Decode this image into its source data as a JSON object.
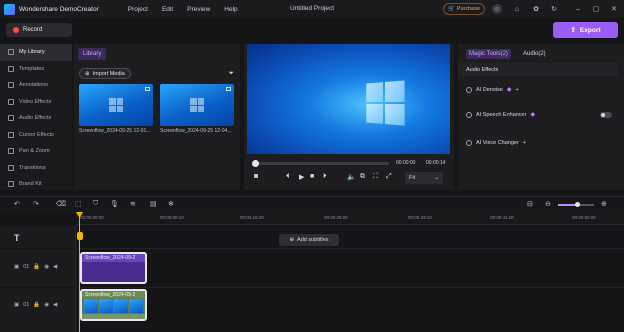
{
  "titlebar": {
    "app_name": "Wondershare DemoCreator",
    "menu": [
      "Project",
      "Edit",
      "Preview",
      "Help"
    ],
    "project_title": "Untitled Project",
    "purchase_label": "Purchase"
  },
  "record_label": "Record",
  "export_label": "Export",
  "sidebar": {
    "items": [
      {
        "label": "My Library",
        "active": true
      },
      {
        "label": "Templates"
      },
      {
        "label": "Annotations"
      },
      {
        "label": "Video Effects"
      },
      {
        "label": "Audio Effects"
      },
      {
        "label": "Cursor Effects"
      },
      {
        "label": "Pan & Zoom"
      },
      {
        "label": "Transitions"
      },
      {
        "label": "Brand Kit"
      }
    ]
  },
  "library": {
    "tab_label": "Library",
    "import_label": "Import Media",
    "items": [
      {
        "name": "Screenflow_2024-09-25 12-01..."
      },
      {
        "name": "Screenflow_2024-09-25 12-04..."
      }
    ]
  },
  "preview": {
    "time_current": "00:00:00",
    "time_total": "00:00:14",
    "fit_label": "Fit",
    "fit_caret": "⌄"
  },
  "right_panel": {
    "tabs": [
      "Magic Tools(2)",
      "Audio(2)"
    ],
    "section_title": "Audio Effects",
    "effects": [
      {
        "label": "AI Denoise"
      },
      {
        "label": "AI Speech Enhancer"
      },
      {
        "label": "AI Voice Changer"
      }
    ]
  },
  "timeline": {
    "ruler_labels": [
      "00:00:00:00",
      "00:00:08:10",
      "00:00:16:20",
      "00:00:25:00",
      "00:00:33:10",
      "00:00:41:20",
      "00:00:50:00"
    ],
    "add_subtitles_label": "Add subtitles",
    "clip_text": "Screenflow_2024-09-2",
    "track_ids": [
      "01",
      "01"
    ]
  },
  "colors": {
    "accent": "#9a5cf5",
    "playhead": "#f5b400",
    "record_dot": "#ff4a4a"
  }
}
